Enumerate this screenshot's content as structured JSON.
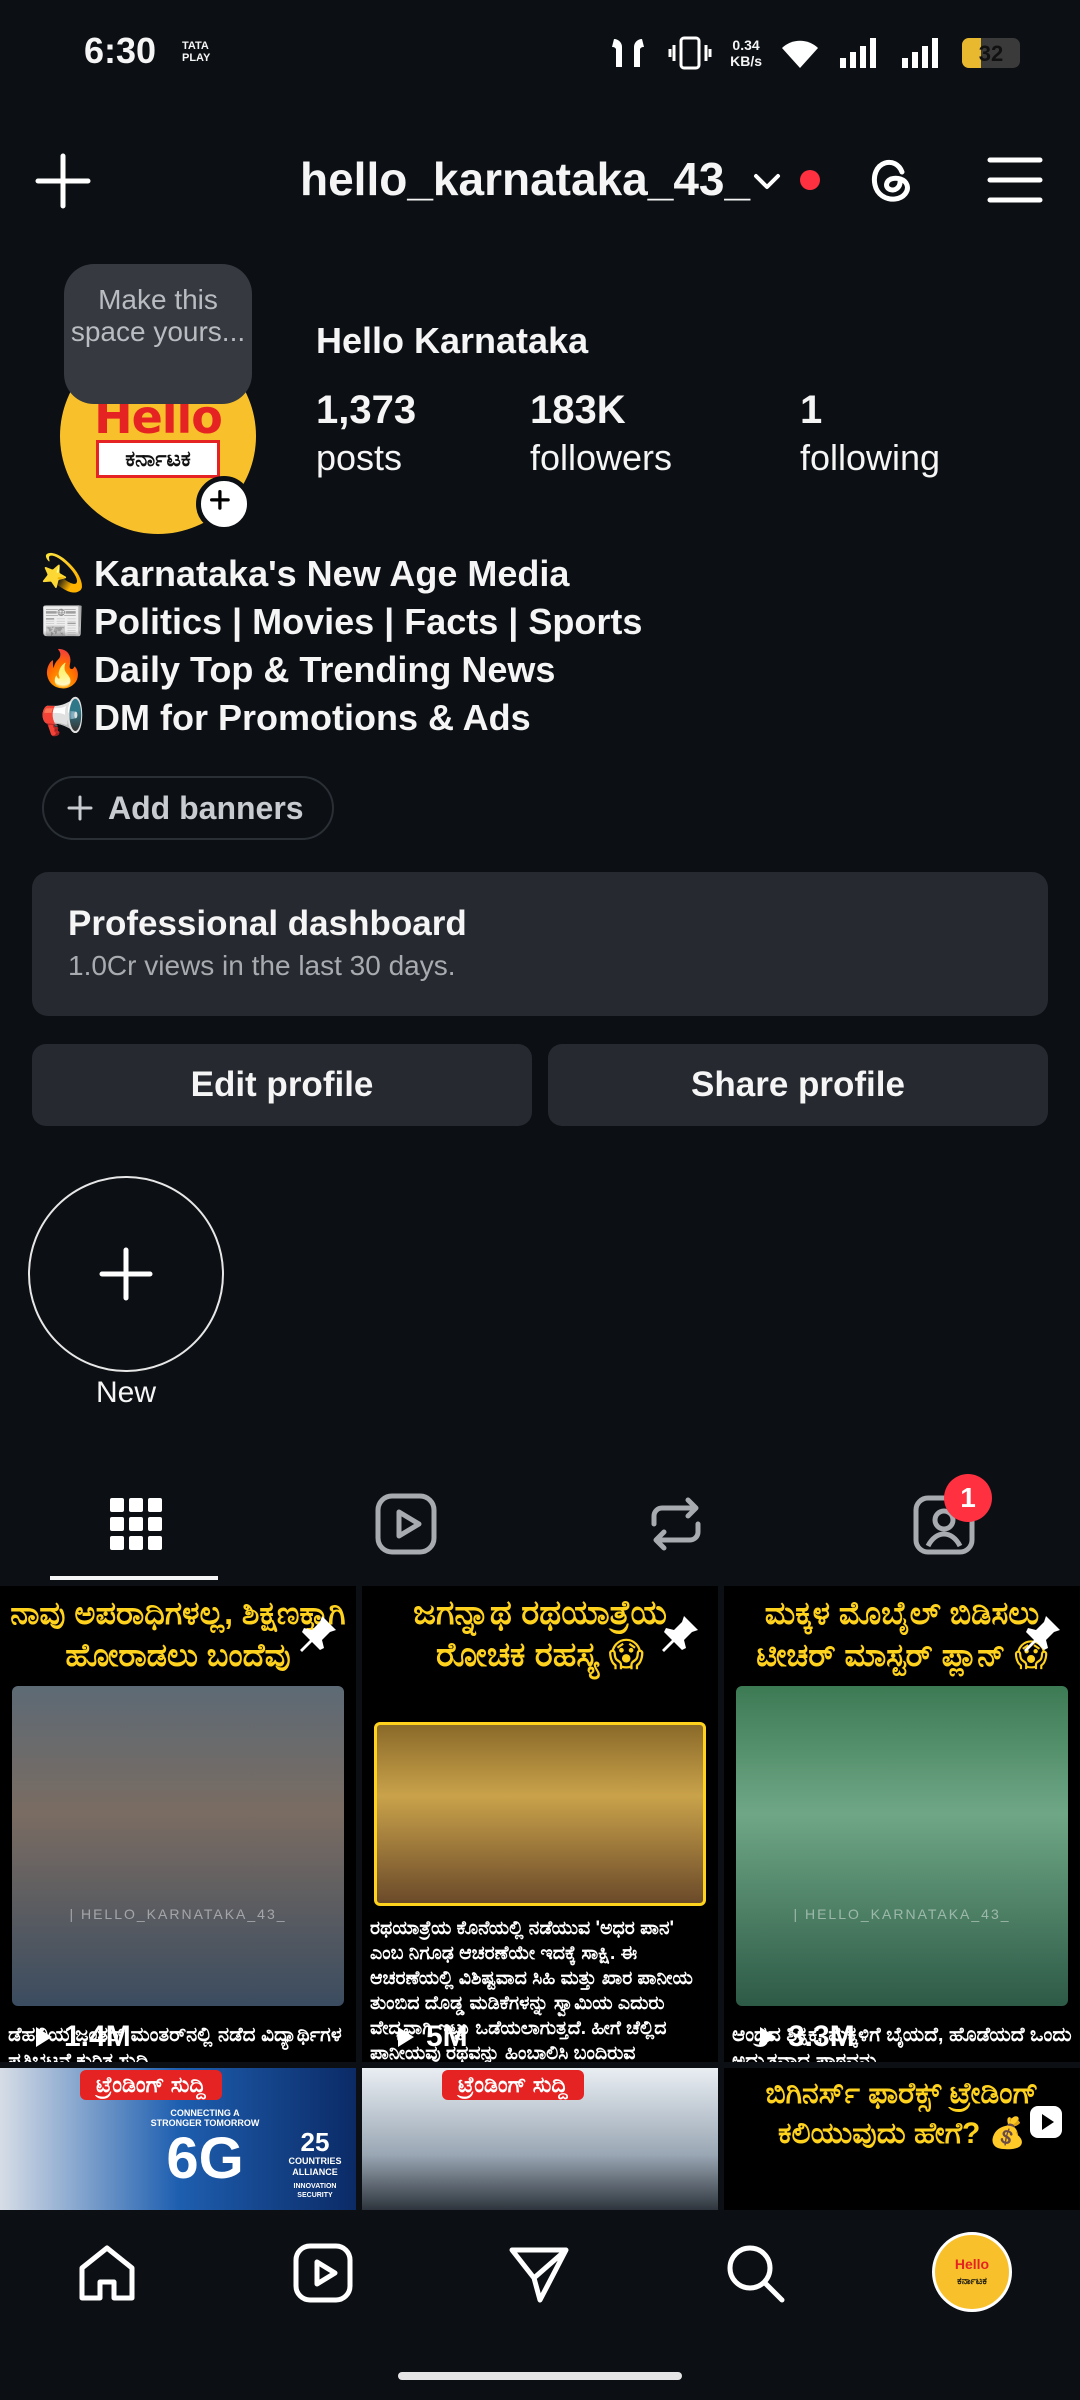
{
  "status_bar": {
    "time": "6:30",
    "carrier_brand": "TATA PLAY",
    "net_speed_value": "0.34",
    "net_speed_unit": "KB/s",
    "battery": "32",
    "battery_level": 0.32
  },
  "header": {
    "username": "hello_karnataka_43_",
    "notification_dot_color": "#ff3040"
  },
  "profile": {
    "note_bubble": "Make this space yours...",
    "display_name": "Hello Karnataka",
    "avatar_logo_line1": "Hello",
    "avatar_logo_line2": "ಕರ್ನಾಟಕ",
    "stats": [
      {
        "value": "1,373",
        "label": "posts"
      },
      {
        "value": "183K",
        "label": "followers"
      },
      {
        "value": "1",
        "label": "following"
      }
    ],
    "bio": [
      {
        "emoji": "💫",
        "text": "Karnataka's New Age Media"
      },
      {
        "emoji": "📰",
        "text": "Politics | Movies | Facts | Sports"
      },
      {
        "emoji": "🔥",
        "text": "Daily Top & Trending News"
      },
      {
        "emoji": "📢",
        "text": "DM for Promotions & Ads"
      }
    ],
    "add_banners": "Add banners"
  },
  "dashboard": {
    "title": "Professional dashboard",
    "subtitle": "1.0Cr views in the last 30 days."
  },
  "buttons": {
    "edit_profile": "Edit profile",
    "share_profile": "Share profile"
  },
  "highlights": {
    "new_label": "New"
  },
  "tabs": {
    "tagged_badge": "1"
  },
  "grid": {
    "posts": [
      {
        "headline": "ನಾವು ಅಪರಾಧಿಗಳಲ್ಲ, ಶಿಕ್ಷಣಕ್ಕಾಗಿ ಹೋರಾಡಲು ಬಂದೆವು",
        "caption": "ಡೆಹಲಿಯ ಜಂತರ್ ಮಂತರ್‌ನಲ್ಲಿ ನಡೆದ ವಿದ್ಯಾರ್ಥಿಗಳ ಪ್ರತಿಭಟನೆ ಕುರಿತ ಸುದ್ದಿ",
        "views": "1.4M",
        "watermark": "| HELLO_KARNATAKA_43_"
      },
      {
        "headline": "ಜಗನ್ನಾಥ ರಥಯಾತ್ರೆಯ ರೋಚಕ ರಹಸ್ಯ 😱",
        "caption": "ರಥಯಾತ್ರೆಯ ಕೊನೆಯಲ್ಲಿ ನಡೆಯುವ 'ಅಧರ ಪಾನ' ಎಂಬ ನಿಗೂಢ ಆಚರಣೆಯೇ ಇದಕ್ಕೆ ಸಾಕ್ಷಿ. ಈ ಆಚರಣೆಯಲ್ಲಿ ವಿಶಿಷ್ಟವಾದ ಸಿಹಿ ಮತ್ತು ಖಾರ ಪಾನೀಯ ತುಂಬಿದ ದೊಡ್ಡ ಮಡಿಕೆಗಳನ್ನು ಸ್ವಾಮಿಯ ಎದುರು ವೇದ್ಯವಾಗಿ ಇಟ್ಟು ಒಡೆಯಲಾಗುತ್ತದೆ. ಹೀಗೆ ಚೆಲ್ಲಿದ ಪಾನೀಯವು ರಥವನ್ನು ಹಿಂಬಾಲಿಸಿ ಬಂದಿರುವ",
        "views": "5M"
      },
      {
        "headline": "ಮಕ್ಕಳ ಮೊಬೈಲ್ ಬಿಡಿಸಲು ಟೀಚರ್ ಮಾಸ್ಟರ್ ಪ್ಲಾನ್ 😱",
        "caption": "ಆಂಧ್ರದ ಶಿಕ್ಷಕ, ಮಕ್ಕಳಿಗೆ ಬೈಯದೆ, ಹೊಡೆಯದೆ ಒಂದು ಅದ್ಭುತವಾದ ಪಾಠವನ್ನು",
        "views": "3.3M",
        "watermark": "| HELLO_KARNATAKA_43_"
      },
      {
        "tag": "ಟ್ರೆಂಡಿಂಗ್ ಸುದ್ದಿ",
        "banner_text": "6G",
        "banner_sub": "CONNECTING A STRONGER TOMORROW",
        "alliance_count": "25",
        "alliance_label": "COUNTRIES ALLIANCE",
        "alliance_sub": "INNOVATION SECURITY"
      },
      {
        "tag": "ಟ್ರೆಂಡಿಂಗ್ ಸುದ್ದಿ"
      },
      {
        "headline": "ಬಿಗಿನರ್ಸ್ ಫಾರೆಕ್ಸ್ ಟ್ರೇಡಿಂಗ್ ಕಲಿಯುವುದು ಹೇಗೆ? 💰"
      }
    ]
  },
  "colors": {
    "background": "#0c1014",
    "card": "#262a30",
    "accent_yellow": "#ffd21e",
    "brand_red": "#e62323",
    "brand_yellow": "#f8c12c"
  }
}
